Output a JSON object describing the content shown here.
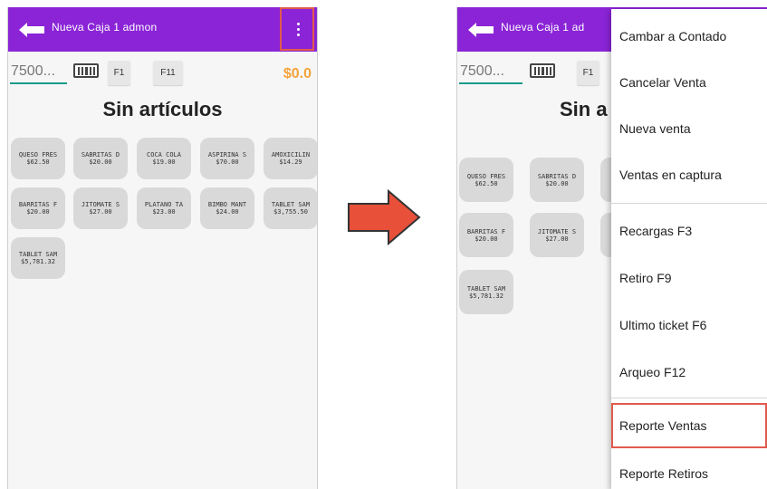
{
  "left_screen": {
    "appbar": {
      "title": "Nueva Caja 1 admon"
    },
    "toolbar": {
      "search_placeholder": "7500...",
      "f1_label": "F1",
      "f11_label": "F11",
      "total": "$0.0"
    },
    "empty_title": "Sin artículos",
    "products": [
      {
        "name": "QUESO FRES",
        "price": "$62.50"
      },
      {
        "name": "SABRITAS D",
        "price": "$20.00"
      },
      {
        "name": "COCA COLA",
        "price": "$19.00"
      },
      {
        "name": "ASPIRINA S",
        "price": "$70.00"
      },
      {
        "name": "AMOXICILIN",
        "price": "$14.29"
      },
      {
        "name": "BARRITAS F",
        "price": "$20.00"
      },
      {
        "name": "JITOMATE S",
        "price": "$27.00"
      },
      {
        "name": "PLATANO TA",
        "price": "$23.00"
      },
      {
        "name": "BIMBO MANT",
        "price": "$24.00"
      },
      {
        "name": "TABLET SAM",
        "price": "$3,755.50"
      },
      {
        "name": "TABLET SAM",
        "price": "$5,781.32"
      }
    ]
  },
  "right_screen": {
    "appbar": {
      "title": "Nueva Caja 1 ad"
    },
    "toolbar": {
      "search_placeholder": "7500...",
      "f1_label": "F1"
    },
    "empty_title": "Sin a",
    "products": [
      {
        "name": "QUESO FRES",
        "price": "$62.50"
      },
      {
        "name": "SABRITAS D",
        "price": "$20.00"
      },
      {
        "name": "BARRITAS F",
        "price": "$20.00"
      },
      {
        "name": "JITOMATE S",
        "price": "$27.00"
      },
      {
        "name": "TABLET SAM",
        "price": "$5,781.32"
      }
    ],
    "menu": {
      "items": [
        {
          "label": "Cambar a Contado"
        },
        {
          "label": "Cancelar Venta"
        },
        {
          "label": "Nueva venta"
        },
        {
          "label": "Ventas en captura"
        },
        {
          "label": "Recargas F3"
        },
        {
          "label": "Retiro F9"
        },
        {
          "label": "Ultimo ticket F6"
        },
        {
          "label": "Arqueo F12"
        },
        {
          "label": "Reporte Ventas"
        },
        {
          "label": "Reporte Retiros"
        }
      ]
    }
  },
  "colors": {
    "appbar": "#8a24d6",
    "accent_total": "#f4a33a",
    "highlight": "#e05a4c",
    "arrow": "#e8503a"
  }
}
